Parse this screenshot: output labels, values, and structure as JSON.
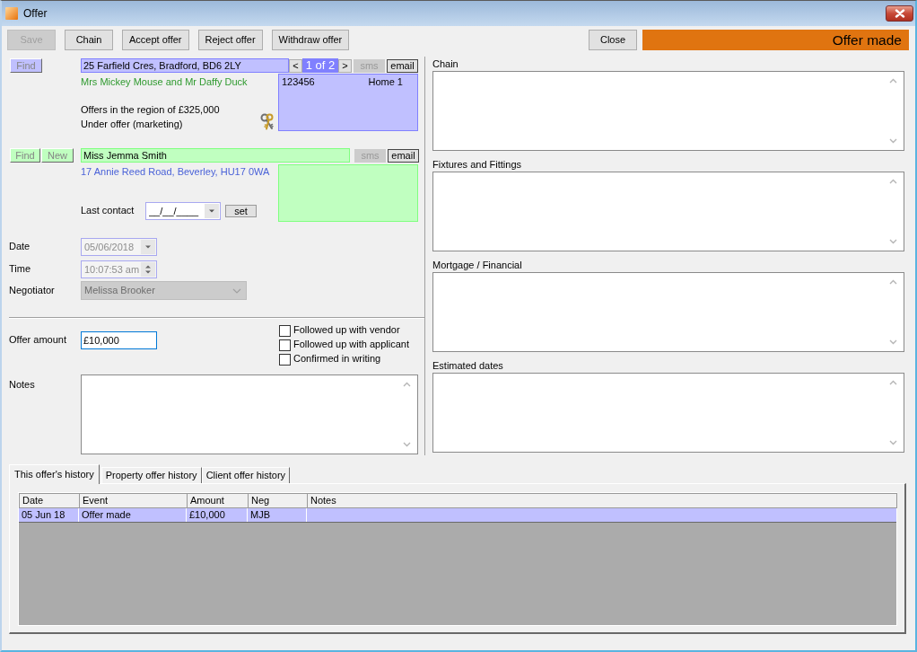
{
  "window": {
    "title": "Offer"
  },
  "toolbar": {
    "buttons": [
      {
        "label": "Save",
        "disabled": true
      },
      {
        "label": "Chain",
        "disabled": false
      },
      {
        "label": "Accept offer",
        "disabled": false
      },
      {
        "label": "Reject offer",
        "disabled": false
      },
      {
        "label": "Withdraw offer",
        "disabled": false
      }
    ],
    "close_button": {
      "label": "Close"
    },
    "status": "Offer made"
  },
  "property": {
    "find_button": {
      "label": "Find",
      "disabled": true
    },
    "address": "25 Farfield Cres, Bradford, BD6 2LY",
    "pager": {
      "prev": "<",
      "position": "1 of 2",
      "next": ">"
    },
    "contact_buttons": [
      {
        "label": "sms",
        "disabled": true
      },
      {
        "label": "email",
        "disabled": false
      }
    ],
    "vendor": "Mrs Mickey Mouse and Mr Daffy Duck",
    "price": "Offers in the region of £325,000",
    "status": "Under offer (marketing)",
    "phone": {
      "number": "123456",
      "label": "Home 1"
    }
  },
  "applicant": {
    "buttons": [
      {
        "label": "Find",
        "disabled": true
      },
      {
        "label": "New",
        "disabled": true
      }
    ],
    "name": "Miss Jemma Smith",
    "contact_buttons": [
      {
        "label": "sms",
        "disabled": true
      },
      {
        "label": "email",
        "disabled": false
      }
    ],
    "address": "17 Annie Reed Road, Beverley, HU17 0WA",
    "last_contact": {
      "label": "Last contact",
      "placeholder": "__/__/____",
      "set_button": "set"
    }
  },
  "details": [
    {
      "kind": "date",
      "label": "Date",
      "value": "05/06/2018",
      "disabled": true
    },
    {
      "kind": "time",
      "label": "Time",
      "value": "10:07:53 am",
      "disabled": true
    },
    {
      "kind": "combo",
      "label": "Negotiator",
      "value": "Melissa Brooker",
      "disabled": true
    }
  ],
  "offer": {
    "amount": {
      "label": "Offer amount",
      "value": "£10,000",
      "focused": true
    },
    "checks": [
      {
        "label": "Followed up with vendor",
        "checked": false
      },
      {
        "label": "Followed up with applicant",
        "checked": false
      },
      {
        "label": "Confirmed in writing",
        "checked": false
      }
    ],
    "notes": {
      "label": "Notes"
    }
  },
  "panels": [
    {
      "label": "Chain"
    },
    {
      "label": "Fixtures and Fittings"
    },
    {
      "label": "Mortgage / Financial"
    },
    {
      "label": "Estimated dates"
    }
  ],
  "history": {
    "tabs": [
      {
        "label": "This offer's history",
        "selected": true
      },
      {
        "label": "Property offer history",
        "selected": false
      },
      {
        "label": "Client offer history",
        "selected": false
      }
    ],
    "table": {
      "columns": [
        "Date",
        "Event",
        "Amount",
        "Neg",
        "Notes"
      ],
      "rows": [
        {
          "cells": [
            "05 Jun 18",
            "Offer made",
            "£10,000",
            "MJB"
          ],
          "selected": true
        }
      ]
    }
  }
}
